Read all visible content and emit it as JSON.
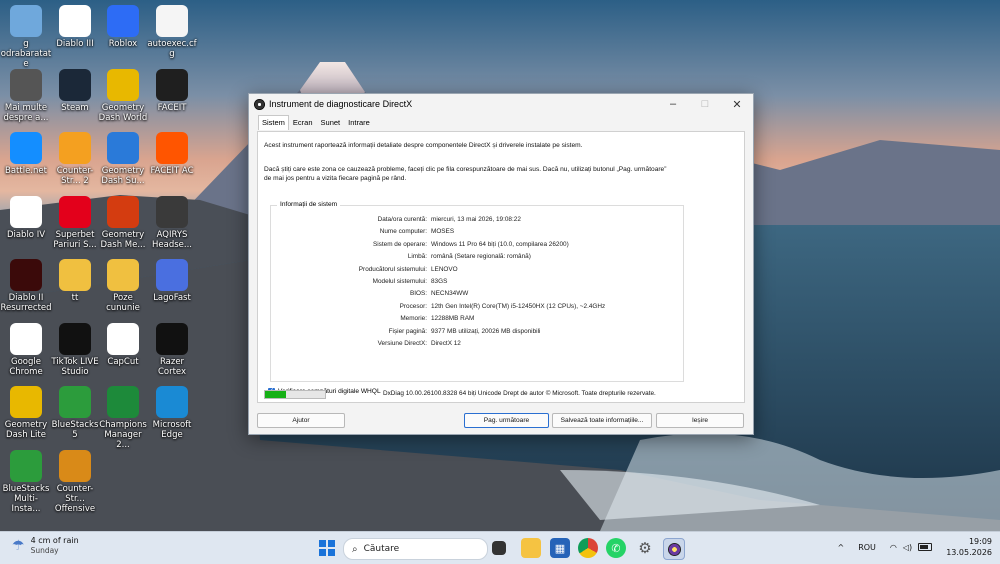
{
  "desktop": {
    "icons": [
      {
        "label": "g\nodrabaratate",
        "icon": "recycle-bin-icon",
        "color": "#6fa8dc"
      },
      {
        "label": "Diablo III",
        "icon": "diablo-iii-icon",
        "color": "#ffffff"
      },
      {
        "label": "Roblox",
        "icon": "roblox-icon",
        "color": "#2d6cf5"
      },
      {
        "label": "autoexec.cfg",
        "icon": "file-icon",
        "color": "#f5f5f5"
      },
      {
        "label": "Mai multe despre a...",
        "icon": "info-icon",
        "color": "#555555"
      },
      {
        "label": "Steam",
        "icon": "steam-icon",
        "color": "#1b2838"
      },
      {
        "label": "Geometry Dash World",
        "icon": "geometry-dash-icon",
        "color": "#e8b800"
      },
      {
        "label": "FACEIT",
        "icon": "faceit-icon",
        "color": "#1f1f1f"
      },
      {
        "label": "Battle.net",
        "icon": "battlenet-icon",
        "color": "#148eff"
      },
      {
        "label": "Counter-Str... 2",
        "icon": "cs2-icon",
        "color": "#f4a020"
      },
      {
        "label": "Geometry Dash Su...",
        "icon": "geometry-dash-icon",
        "color": "#2a7ad9"
      },
      {
        "label": "FACEIT AC",
        "icon": "faceit-ac-icon",
        "color": "#ff5500"
      },
      {
        "label": "Diablo IV",
        "icon": "diablo-iv-icon",
        "color": "#ffffff"
      },
      {
        "label": "Superbet Pariuri S...",
        "icon": "superbet-icon",
        "color": "#e3001b"
      },
      {
        "label": "Geometry Dash Me...",
        "icon": "geometry-dash-icon",
        "color": "#d43c10"
      },
      {
        "label": "AQIRYS Headse...",
        "icon": "aqirys-icon",
        "color": "#3a3a3a"
      },
      {
        "label": "Diablo II Resurrected",
        "icon": "diablo-ii-icon",
        "color": "#3b0a0a"
      },
      {
        "label": "tt",
        "icon": "folder-icon",
        "color": "#f0c040"
      },
      {
        "label": "Poze cununie",
        "icon": "folder-icon",
        "color": "#f0c040"
      },
      {
        "label": "LagoFast",
        "icon": "lagofast-icon",
        "color": "#4a6fe0"
      },
      {
        "label": "Google Chrome",
        "icon": "chrome-icon",
        "color": "#ffffff"
      },
      {
        "label": "TikTok LIVE Studio",
        "icon": "tiktok-icon",
        "color": "#111111"
      },
      {
        "label": "CapCut",
        "icon": "capcut-icon",
        "color": "#ffffff"
      },
      {
        "label": "Razer Cortex",
        "icon": "razer-cortex-icon",
        "color": "#111111"
      },
      {
        "label": "Geometry Dash Lite",
        "icon": "geometry-dash-icon",
        "color": "#e8b800"
      },
      {
        "label": "BlueStacks 5",
        "icon": "bluestacks-icon",
        "color": "#2c9c3c"
      },
      {
        "label": "Champions Manager 2...",
        "icon": "champions-manager-icon",
        "color": "#1d8a3a"
      },
      {
        "label": "Microsoft Edge",
        "icon": "edge-icon",
        "color": "#1a8ad4"
      },
      {
        "label": "BlueStacks Multi-Insta...",
        "icon": "bluestacks-multi-icon",
        "color": "#2c9c3c"
      },
      {
        "label": "Counter-Str... Offensive",
        "icon": "csgo-icon",
        "color": "#d98a18"
      }
    ]
  },
  "window": {
    "title": "Instrument de diagnosticare DirectX",
    "controls": {
      "minimize": "–",
      "maximize": "□",
      "close": "✕"
    },
    "tabs": [
      "Sistem",
      "Ecran",
      "Sunet",
      "Intrare"
    ],
    "intro1": "Acest instrument raportează informații detaliate despre componentele DirectX și driverele instalate pe sistem.",
    "intro2a": "Dacă știți care este zona ce cauzează probleme, faceți clic pe fila corespunzătoare de mai sus. Dacă nu, utilizați butonul „Pag. următoare”",
    "intro2b": "de mai jos pentru a vizita fiecare pagină pe rând.",
    "info_title": "Informații de sistem",
    "info_rows": [
      {
        "k": "Data/ora curentă:",
        "v": "miercuri, 13 mai 2026, 19:08:22"
      },
      {
        "k": "Nume computer:",
        "v": "MOSES"
      },
      {
        "k": "Sistem de operare:",
        "v": "Windows 11 Pro 64 biți (10.0, compilarea 26200)"
      },
      {
        "k": "Limbă:",
        "v": "română (Setare regională: română)"
      },
      {
        "k": "Producătorul sistemului:",
        "v": "LENOVO"
      },
      {
        "k": "Modelul sistemului:",
        "v": "83GS"
      },
      {
        "k": "BIOS:",
        "v": "NECN34WW"
      },
      {
        "k": "Procesor:",
        "v": "12th Gen Intel(R) Core(TM) i5-12450HX (12 CPUs), ~2.4GHz"
      },
      {
        "k": "Memorie:",
        "v": "12288MB RAM"
      },
      {
        "k": "Fișier pagină:",
        "v": "9377 MB utilizați, 20026 MB disponibili"
      },
      {
        "k": "Versiune DirectX:",
        "v": "DirectX 12"
      }
    ],
    "whql_label": "Verificare semnături digitale WHQL",
    "whql_checked": true,
    "progress": 0.35,
    "dxdiag_version": "DxDiag 10.00.26100.8328 64 biți Unicode  Drept de autor © Microsoft. Toate drepturile rezervate.",
    "buttons": {
      "help": "Ajutor",
      "next": "Pag. următoare",
      "save": "Salvează toate informațiile...",
      "exit": "Ieșire"
    }
  },
  "taskbar": {
    "weather_line1": "4 cm of rain",
    "weather_line2": "Sunday",
    "search_placeholder": "Căutare",
    "apps": [
      "windows-start-icon",
      "search",
      "task-view-icon",
      "file-explorer-icon",
      "microsoft-store-icon",
      "chrome-icon",
      "whatsapp-icon",
      "settings-icon",
      "dxdiag-icon"
    ],
    "tray_chevron": "^",
    "language": "ROU",
    "time": "19:09",
    "date": "13.05.2026"
  }
}
